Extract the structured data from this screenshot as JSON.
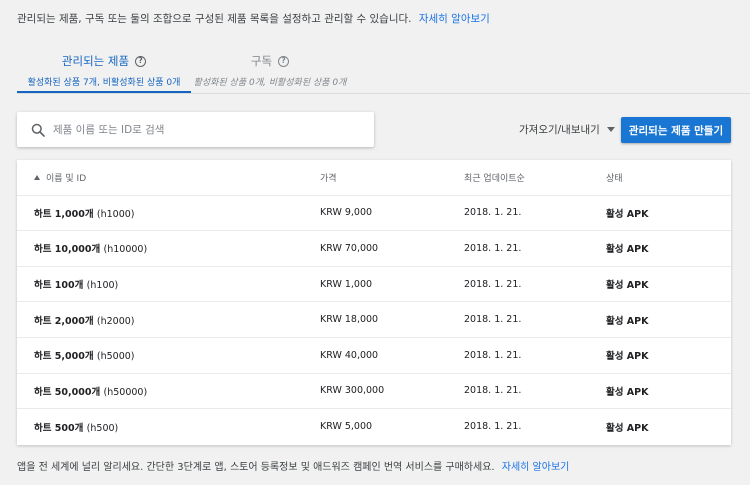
{
  "intro": {
    "text": "관리되는 제품, 구독 또는 둘의 조합으로 구성된 제품 목록을 설정하고 관리할 수 있습니다.",
    "link": "자세히 알아보기"
  },
  "tabs": [
    {
      "title": "관리되는 제품",
      "subtitle": "활성화된 상품 7개, 비활성화된 상품 0개",
      "active": true
    },
    {
      "title": "구독",
      "subtitle": "활성화된 상품 0개, 비활성화된 상품 0개",
      "active": false
    }
  ],
  "search": {
    "placeholder": "제품 이름 또는 ID로 검색",
    "value": ""
  },
  "import_export": {
    "label": "가져오기/내보내기"
  },
  "create_button": {
    "label": "관리되는 제품 만들기"
  },
  "colors": {
    "accent": "#1565c0",
    "button": "#1976d2"
  },
  "table": {
    "headers": {
      "name": "이름 및 ID",
      "price": "가격",
      "updated": "최근 업데이트순",
      "status": "상태"
    },
    "rows": [
      {
        "name": "하트 1,000개",
        "id": "(h1000)",
        "price": "KRW 9,000",
        "updated": "2018. 1. 21.",
        "status": "활성 APK"
      },
      {
        "name": "하트 10,000개",
        "id": "(h10000)",
        "price": "KRW 70,000",
        "updated": "2018. 1. 21.",
        "status": "활성 APK"
      },
      {
        "name": "하트 100개",
        "id": "(h100)",
        "price": "KRW 1,000",
        "updated": "2018. 1. 21.",
        "status": "활성 APK"
      },
      {
        "name": "하트 2,000개",
        "id": "(h2000)",
        "price": "KRW 18,000",
        "updated": "2018. 1. 21.",
        "status": "활성 APK"
      },
      {
        "name": "하트 5,000개",
        "id": "(h5000)",
        "price": "KRW 40,000",
        "updated": "2018. 1. 21.",
        "status": "활성 APK"
      },
      {
        "name": "하트 50,000개",
        "id": "(h50000)",
        "price": "KRW 300,000",
        "updated": "2018. 1. 21.",
        "status": "활성 APK"
      },
      {
        "name": "하트 500개",
        "id": "(h500)",
        "price": "KRW 5,000",
        "updated": "2018. 1. 21.",
        "status": "활성 APK"
      }
    ]
  },
  "footer": {
    "text": "앱을 전 세계에 널리 알리세요. 간단한 3단계로 앱, 스토어 등록정보 및 애드워즈 캠페인 번역 서비스를 구매하세요.",
    "link": "자세히 알아보기"
  }
}
